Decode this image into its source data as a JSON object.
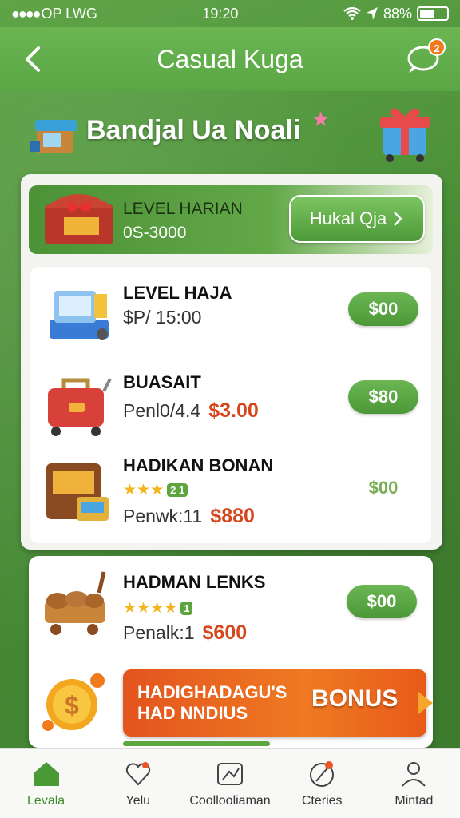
{
  "status_bar": {
    "carrier": "OP LWG",
    "time": "19:20",
    "battery": "88%"
  },
  "header": {
    "title": "Casual Kuga",
    "chat_badge": "2"
  },
  "banner": {
    "title": "Bandjal Ua Noali"
  },
  "featured": {
    "title": "LEVEL HARIAN",
    "subtitle": "0S-3000",
    "button_label": "Hukal Qja"
  },
  "items": [
    {
      "name": "LEVEL HAJA",
      "meta": "$P/ 15:00",
      "price": "",
      "button": "$00"
    },
    {
      "name": "BUASAIT",
      "meta": "Penl0/4.4",
      "price": "$3.00",
      "button": "$80"
    },
    {
      "name": "HADIKAN BONAN",
      "stars": "★★★",
      "level": "2 1",
      "meta": "Penwk:11",
      "price": "$880",
      "button": "$00"
    }
  ],
  "item4": {
    "name": "HADMAN LENKS",
    "stars": "★★★★",
    "level": "1",
    "meta": "Penalk:1",
    "price": "$600",
    "button": "$00"
  },
  "bonus": {
    "text_line1": "HADIGHADAGU'S",
    "text_line2": "HAD NNDIUS",
    "tag": "BONUS"
  },
  "tabs": [
    {
      "label": "Levala",
      "active": true
    },
    {
      "label": "Yelu"
    },
    {
      "label": "Coollooliaman"
    },
    {
      "label": "Cteries"
    },
    {
      "label": "Mintad"
    }
  ],
  "colors": {
    "primary_green": "#5aa645",
    "accent_orange": "#ef7a22",
    "price_red": "#d6461c"
  }
}
